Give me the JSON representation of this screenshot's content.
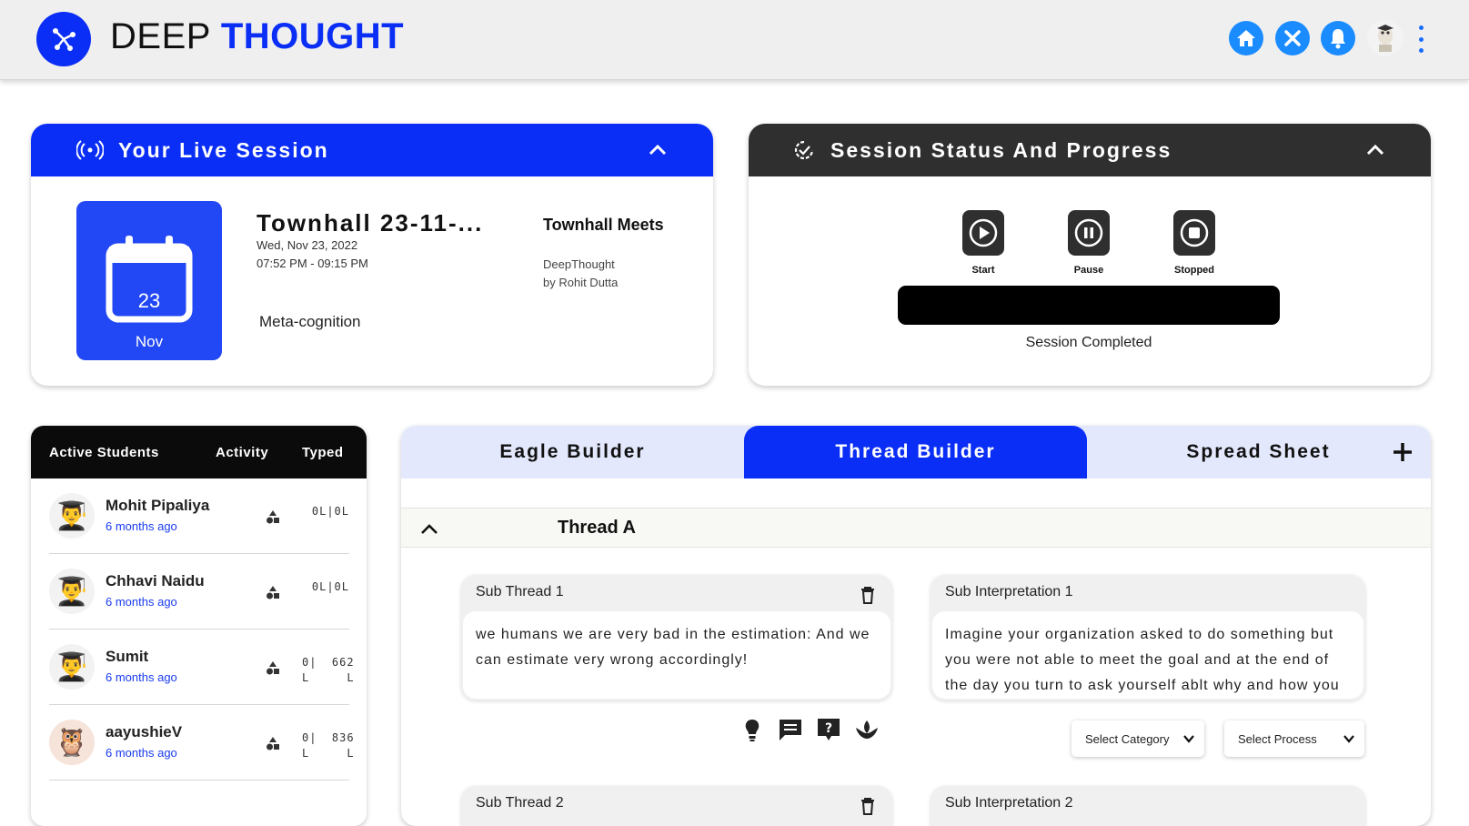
{
  "header": {
    "brand_part1": "DEEP",
    "brand_part2": "THOUGHT",
    "icons": [
      "home-icon",
      "tools-icon",
      "bell-icon",
      "avatar",
      "more-vert-icon"
    ]
  },
  "live_session": {
    "title": "Your Live Session",
    "calendar_day": "23",
    "calendar_month": "Nov",
    "session_title": "Townhall 23-11-...",
    "date": "Wed, Nov 23, 2022",
    "time": "07:52 PM - 09:15 PM",
    "tag": "Meta-cognition",
    "org_title": "Townhall Meets",
    "org_name": "DeepThought",
    "org_by": "by Rohit Dutta"
  },
  "session_status": {
    "title": "Session Status And Progress",
    "start_label": "Start",
    "pause_label": "Pause",
    "stopped_label": "Stopped",
    "progress_fraction": 1.0,
    "progress_text": "Session Completed"
  },
  "students": {
    "col_active": "Active Students",
    "col_activity": "Activity",
    "col_typed": "Typed",
    "rows": [
      {
        "name": "Mohit Pipaliya",
        "time": "6 months ago",
        "typed": "0L|0L"
      },
      {
        "name": "Chhavi Naidu",
        "time": "6 months ago",
        "typed": "0L|0L"
      },
      {
        "name": "Sumit",
        "time": "6 months ago",
        "typed": "0|  662\nL     L"
      },
      {
        "name": "aayushieV",
        "time": "6 months ago",
        "typed": "0|  836\nL     L"
      }
    ]
  },
  "builder": {
    "tabs": [
      "Eagle Builder",
      "Thread Builder",
      "Spread Sheet"
    ],
    "active_tab": "Thread Builder",
    "thread_title": "Thread A",
    "sub_thread_1_label": "Sub Thread 1",
    "sub_thread_1_text": "we humans we are very bad in the estimation: And we can estimate very wrong accordingly!",
    "sub_interp_1_label": "Sub Interpretation 1",
    "sub_interp_1_text": "Imagine your organization asked to do something but you were not able to meet the goal and at the end of the day you turn to ask yourself ablt why and how you",
    "select_category": "Select Category",
    "select_process": "Select Process",
    "sub_thread_2_label": "Sub Thread 2",
    "sub_interp_2_label": "Sub Interpretation 2"
  },
  "colors": {
    "brand_blue": "#0a2ef5",
    "dark": "#2f2f2f",
    "icon_blue": "#1a8cff"
  }
}
